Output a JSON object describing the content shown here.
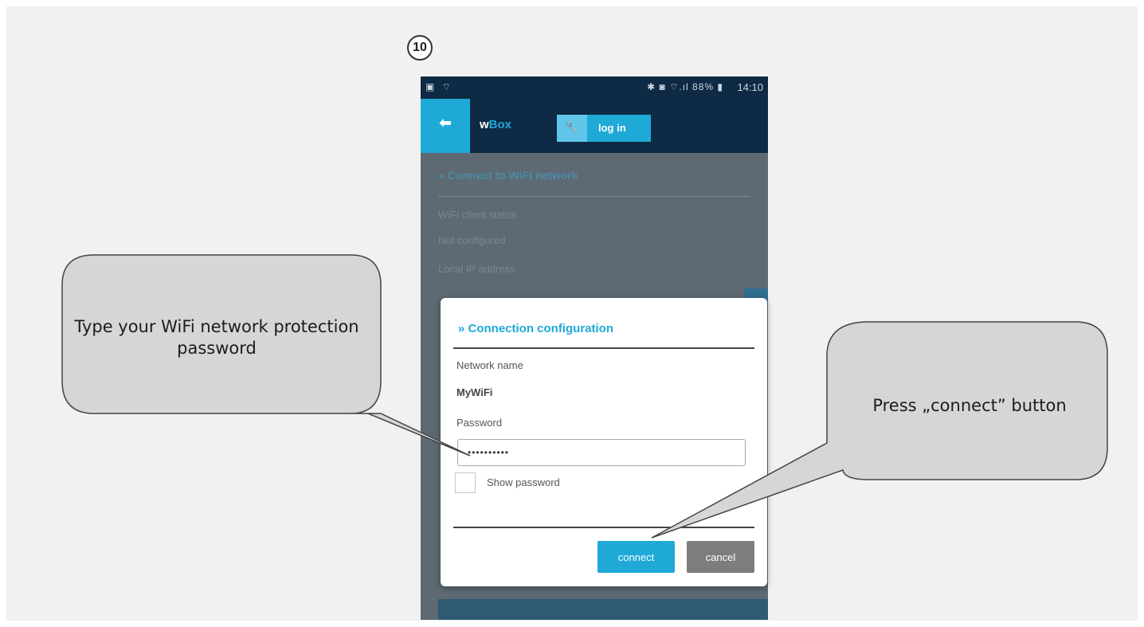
{
  "step": {
    "number": "10"
  },
  "statusbar": {
    "left_icons": "▣ ⌔",
    "right_icons": "✱ ◙ ⌔.ıl 88% ▮",
    "time": "14:10"
  },
  "appbar": {
    "title_prefix": "w",
    "title_suffix": "Box",
    "login_label": "log in",
    "colors": {
      "bar": "#0e2a44",
      "accent": "#1fa9d6"
    }
  },
  "background_page": {
    "heading": "» Connect to WiFi network",
    "row1": "WiFi client status",
    "row2": "Not configured",
    "row3": "Local IP address"
  },
  "dialog": {
    "title": "» Connection configuration",
    "network_name_label": "Network name",
    "network_name_value": "MyWiFi",
    "password_label": "Password",
    "password_value": "••••••••••",
    "show_password_label": "Show password",
    "connect_label": "connect",
    "cancel_label": "cancel"
  },
  "callouts": {
    "left": "Type your WiFi network protection password",
    "right": "Press „connect” button"
  },
  "icons": {
    "back": "back-arrow-icon",
    "login": "wrench-icon"
  }
}
